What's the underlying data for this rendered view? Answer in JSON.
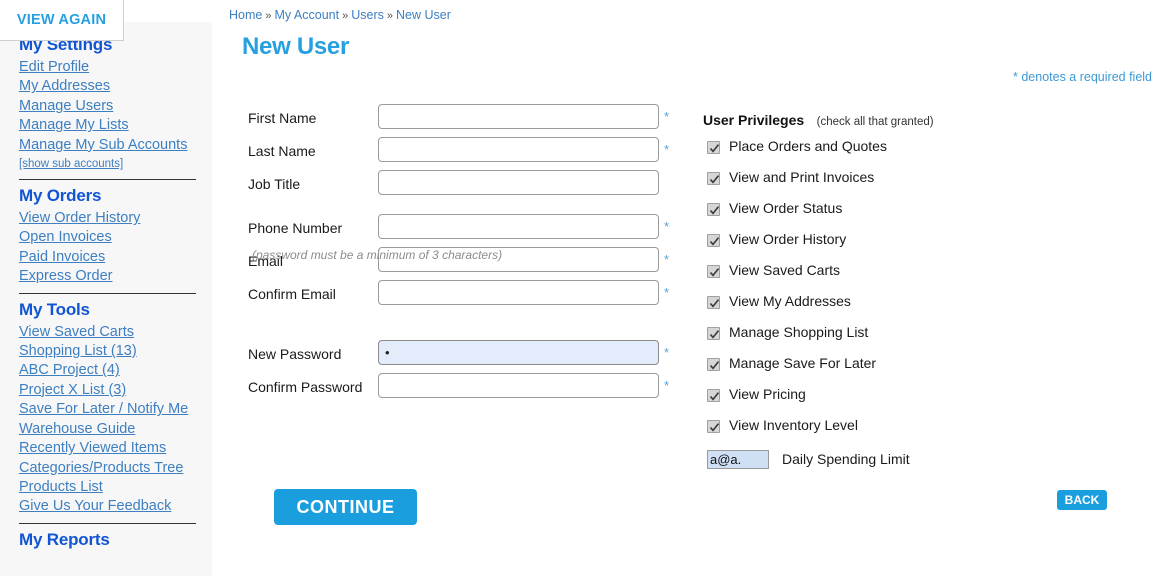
{
  "overlay": {
    "view_again_label": "VIEW AGAIN"
  },
  "sidebar": {
    "sections": [
      {
        "heading": "My Settings",
        "links": [
          {
            "label": "Edit Profile",
            "small": false
          },
          {
            "label": "My Addresses",
            "small": false
          },
          {
            "label": "Manage Users",
            "small": false
          },
          {
            "label": "Manage My Lists",
            "small": false
          },
          {
            "label": "Manage My Sub Accounts",
            "small": false
          },
          {
            "label": "[show sub accounts]",
            "small": true
          }
        ]
      },
      {
        "heading": "My Orders",
        "links": [
          {
            "label": "View Order History",
            "small": false
          },
          {
            "label": "Open Invoices",
            "small": false
          },
          {
            "label": "Paid Invoices",
            "small": false
          },
          {
            "label": "Express Order",
            "small": false
          }
        ]
      },
      {
        "heading": "My Tools",
        "links": [
          {
            "label": "View Saved Carts",
            "small": false
          },
          {
            "label": "Shopping List (13)",
            "small": false
          },
          {
            "label": "ABC Project (4)",
            "small": false
          },
          {
            "label": "Project X List (3)",
            "small": false
          },
          {
            "label": "Save For Later / Notify Me",
            "small": false
          },
          {
            "label": "Warehouse Guide",
            "small": false
          },
          {
            "label": "Recently Viewed Items",
            "small": false
          },
          {
            "label": "Categories/Products Tree",
            "small": false
          },
          {
            "label": "Products List",
            "small": false
          },
          {
            "label": "Give Us Your Feedback",
            "small": false
          }
        ]
      },
      {
        "heading": "My Reports",
        "links": []
      }
    ]
  },
  "breadcrumb": {
    "items": [
      "Home",
      "My Account",
      "Users",
      "New User"
    ],
    "separator": "»"
  },
  "page": {
    "title": "New User",
    "required_note": "* denotes a required field",
    "password_note": "(password must be a minimum of 3 characters)"
  },
  "form": {
    "fields": [
      {
        "label": "First Name",
        "value": "",
        "required": true,
        "filled": false
      },
      {
        "label": "Last Name",
        "value": "",
        "required": true,
        "filled": false
      },
      {
        "label": "Job Title",
        "value": "",
        "required": false,
        "filled": false
      },
      {
        "label": "Phone Number",
        "value": "",
        "required": true,
        "filled": false
      },
      {
        "label": "Email",
        "value": "",
        "required": true,
        "filled": false
      },
      {
        "label": "Confirm Email",
        "value": "",
        "required": true,
        "filled": false
      },
      {
        "label": "New Password",
        "value": "•",
        "required": true,
        "filled": true
      },
      {
        "label": "Confirm Password",
        "value": "",
        "required": true,
        "filled": false
      }
    ]
  },
  "privileges": {
    "title": "User Privileges",
    "subtitle": "(check all that granted)",
    "items": [
      {
        "label": "Place Orders and Quotes",
        "checked": true
      },
      {
        "label": "View and Print Invoices",
        "checked": true
      },
      {
        "label": "View Order Status",
        "checked": true
      },
      {
        "label": "View Order History",
        "checked": true
      },
      {
        "label": "View Saved Carts",
        "checked": true
      },
      {
        "label": "View My Addresses",
        "checked": true
      },
      {
        "label": "Manage Shopping List",
        "checked": true
      },
      {
        "label": "Manage Save For Later",
        "checked": true
      },
      {
        "label": "View Pricing",
        "checked": true
      },
      {
        "label": "View Inventory Level",
        "checked": true
      }
    ],
    "spending_limit": {
      "label": "Daily Spending Limit",
      "value": "a@a."
    }
  },
  "buttons": {
    "continue": "CONTINUE",
    "back": "BACK"
  },
  "colors": {
    "accent_blue": "#1a9ede",
    "link_blue": "#3d7fc1",
    "heading_blue": "#1155d4",
    "sidebar_bg": "#f7f7f7",
    "autofill_bg": "#e3ecfb"
  }
}
